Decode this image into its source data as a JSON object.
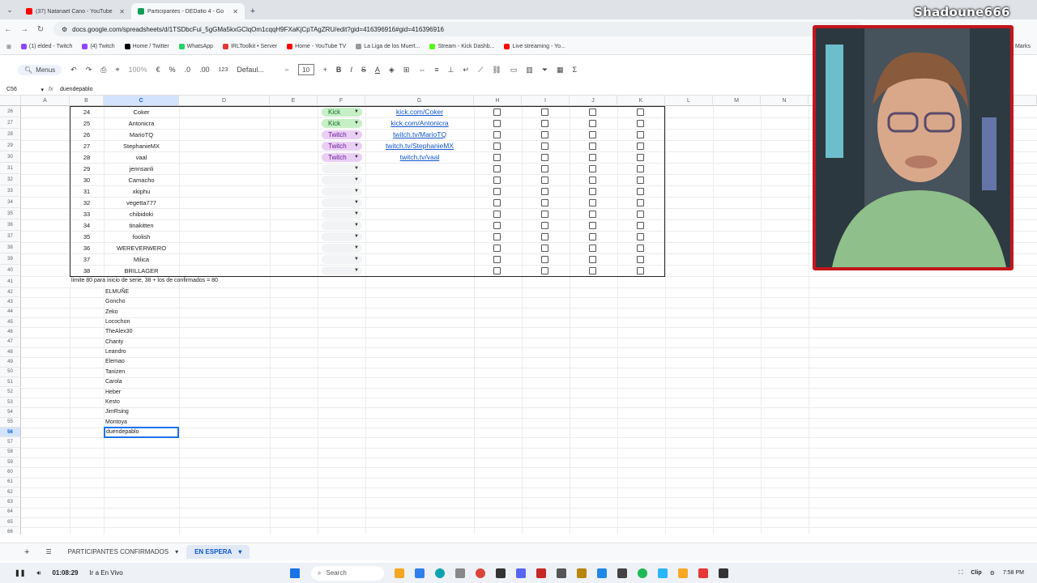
{
  "browser": {
    "tabs": [
      {
        "title": "(37) Natanael Cano - YouTube",
        "active": false,
        "color": "#ff0000"
      },
      {
        "title": "Participantes - DEDafio 4 - Go",
        "active": true,
        "color": "#0f9d58"
      }
    ],
    "url": "docs.google.com/spreadsheets/d/1TSDbcFui_5gGMa5kxGClqOm1cqqH9FXaKjCpTAgZRU/edit?gid=416396916#gid=416396916",
    "bookmarks": [
      {
        "label": "(1) elded - Twitch",
        "color": "#9146ff"
      },
      {
        "label": "(4) Twitch",
        "color": "#9146ff"
      },
      {
        "label": "Home / Twitter",
        "color": "#000000"
      },
      {
        "label": "WhatsApp",
        "color": "#25d366"
      },
      {
        "label": "IRLToolkit • Server",
        "color": "#e53935"
      },
      {
        "label": "Home - YouTube TV",
        "color": "#ff0000"
      },
      {
        "label": "La Liga de los Muert...",
        "color": "#999999"
      },
      {
        "label": "Stream - Kick Dashb...",
        "color": "#53fc18"
      },
      {
        "label": "Live streaming - Yo...",
        "color": "#ff0000"
      }
    ],
    "bookmarks_overflow": "Marks"
  },
  "toolbar": {
    "menus_label": "Menus",
    "zoom": "100%",
    "currency": "€",
    "percent": "%",
    "dec_decrease": ".0",
    "dec_increase": ".00",
    "number_format": "123",
    "font_name": "Defaul...",
    "font_size": "10",
    "bold": "B",
    "italic": "I",
    "strike": "S",
    "text_color": "A"
  },
  "formula_bar": {
    "cell_ref": "C56",
    "fx": "fx",
    "content": "duendepablo"
  },
  "columns": [
    "A",
    "B",
    "C",
    "D",
    "E",
    "F",
    "G",
    "H",
    "I",
    "J",
    "K",
    "L",
    "M",
    "N"
  ],
  "selected_column": "C",
  "selected_row": "56",
  "participants": [
    {
      "row": "26",
      "num": "24",
      "name": "Coker",
      "platform": "Kick",
      "link": "kick.com/Coker"
    },
    {
      "row": "27",
      "num": "25",
      "name": "Antonicra",
      "platform": "Kick",
      "link": "kick.com/Antonicra"
    },
    {
      "row": "28",
      "num": "26",
      "name": "MarioTQ",
      "platform": "Twitch",
      "link": "twitch.tv/MarioTQ"
    },
    {
      "row": "29",
      "num": "27",
      "name": "StephanieMX",
      "platform": "Twitch",
      "link": "twitch.tv/StephanieMX"
    },
    {
      "row": "30",
      "num": "28",
      "name": "vaal",
      "platform": "Twitch",
      "link": "twitch.tv/vaal"
    },
    {
      "row": "31",
      "num": "29",
      "name": "jennsanli",
      "platform": "",
      "link": ""
    },
    {
      "row": "32",
      "num": "30",
      "name": "Camacho",
      "platform": "",
      "link": ""
    },
    {
      "row": "33",
      "num": "31",
      "name": "xkiphu",
      "platform": "",
      "link": ""
    },
    {
      "row": "34",
      "num": "32",
      "name": "vegetta777",
      "platform": "",
      "link": ""
    },
    {
      "row": "35",
      "num": "33",
      "name": "chibidoki",
      "platform": "",
      "link": ""
    },
    {
      "row": "36",
      "num": "34",
      "name": "tinakitten",
      "platform": "",
      "link": ""
    },
    {
      "row": "37",
      "num": "35",
      "name": "foolish",
      "platform": "",
      "link": ""
    },
    {
      "row": "38",
      "num": "36",
      "name": "WEREVERWERO",
      "platform": "",
      "link": ""
    },
    {
      "row": "39",
      "num": "37",
      "name": "Milica",
      "platform": "",
      "link": ""
    },
    {
      "row": "40",
      "num": "38",
      "name": "BRILLAGER",
      "platform": "",
      "link": ""
    }
  ],
  "note": {
    "row": "41",
    "text": "limite 80 para inicio de serie, 38 + los de confirmados = 80"
  },
  "waiting": [
    {
      "row": "42",
      "name": "ELMUÑE"
    },
    {
      "row": "43",
      "name": "Goncho"
    },
    {
      "row": "44",
      "name": "Zeko"
    },
    {
      "row": "45",
      "name": "Locochon"
    },
    {
      "row": "46",
      "name": "TheAlex30"
    },
    {
      "row": "47",
      "name": "Chanty"
    },
    {
      "row": "48",
      "name": "Leandro"
    },
    {
      "row": "49",
      "name": "Elemao"
    },
    {
      "row": "50",
      "name": "Tanizen"
    },
    {
      "row": "51",
      "name": "Carola"
    },
    {
      "row": "52",
      "name": "Heber"
    },
    {
      "row": "53",
      "name": "Kesto"
    },
    {
      "row": "54",
      "name": "JimRsing"
    },
    {
      "row": "55",
      "name": "Montoya"
    },
    {
      "row": "56",
      "name": "duendepablo"
    }
  ],
  "empty_rows": [
    "57",
    "58",
    "59",
    "60",
    "61",
    "62",
    "63",
    "64",
    "65",
    "66"
  ],
  "sheet_tabs": {
    "add": "+",
    "tab1": "PARTICIPANTES CONFIRMADOS",
    "tab2": "EN ESPERA"
  },
  "taskbar": {
    "time": "01:08:29",
    "live_label": "Ir a En Vivo",
    "search_placeholder": "Search",
    "clip_label": "Clip",
    "clock": "7:58 PM"
  },
  "overlay": {
    "channel_name": "Shadoune666",
    "cam_border_color": "#c3161c"
  },
  "colors": {
    "kick": "#c6efc6",
    "twitch": "#eacff4",
    "selection": "#1a73e8",
    "link": "#1155cc"
  }
}
